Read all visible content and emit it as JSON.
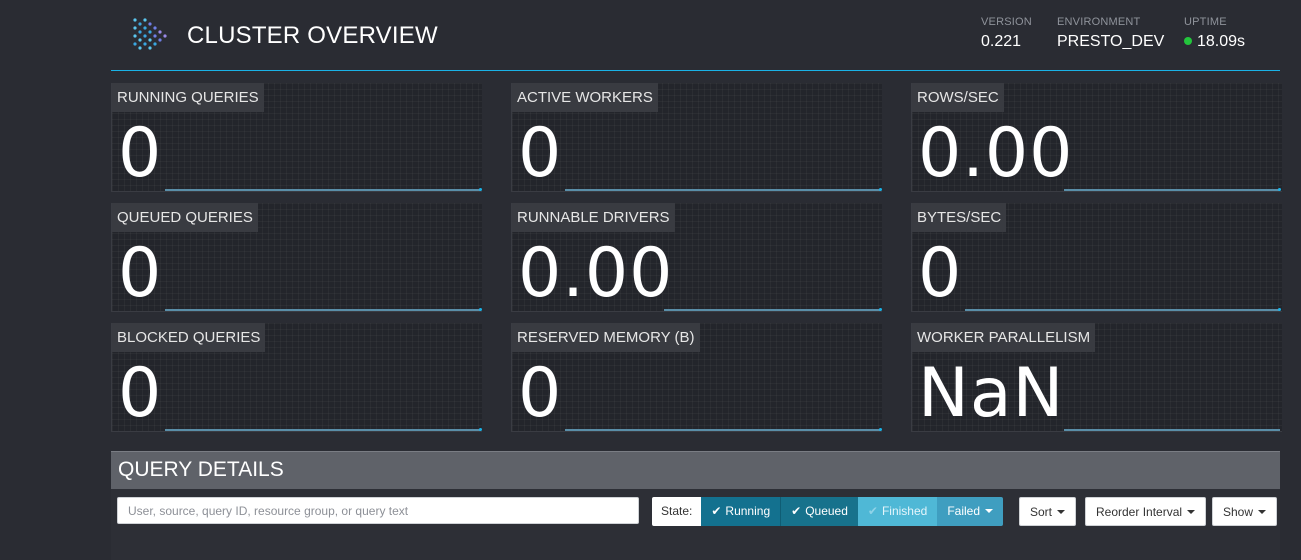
{
  "header": {
    "title": "CLUSTER OVERVIEW",
    "version": {
      "label": "VERSION",
      "value": "0.221"
    },
    "environment": {
      "label": "ENVIRONMENT",
      "value": "PRESTO_DEV"
    },
    "uptime": {
      "label": "UPTIME",
      "value": "18.09s",
      "status_color": "#23c53c"
    }
  },
  "stats": [
    {
      "label": "RUNNING QUERIES",
      "value": "0"
    },
    {
      "label": "ACTIVE WORKERS",
      "value": "0"
    },
    {
      "label": "ROWS/SEC",
      "value": "0.00"
    },
    {
      "label": "QUEUED QUERIES",
      "value": "0"
    },
    {
      "label": "RUNNABLE DRIVERS",
      "value": "0.00"
    },
    {
      "label": "BYTES/SEC",
      "value": "0"
    },
    {
      "label": "BLOCKED QUERIES",
      "value": "0"
    },
    {
      "label": "RESERVED MEMORY (B)",
      "value": "0"
    },
    {
      "label": "WORKER PARALLELISM",
      "value": "NaN"
    }
  ],
  "query_details": {
    "title": "QUERY DETAILS",
    "search_placeholder": "User, source, query ID, resource group, or query text",
    "state_label": "State:",
    "state_filters": [
      {
        "label": "Running",
        "checked": true,
        "color": "#13718f"
      },
      {
        "label": "Queued",
        "checked": true,
        "color": "#17728c"
      },
      {
        "label": "Finished",
        "checked": false,
        "color": "#4fb8d6"
      },
      {
        "label": "Failed",
        "dropdown": true,
        "color": "#3f9ec0"
      }
    ],
    "sort_label": "Sort",
    "reorder_label": "Reorder Interval",
    "show_label": "Show"
  },
  "colors": {
    "background": "#2a2c33",
    "accent": "#1ab2e6",
    "tile_label_bg": "#393b41",
    "details_bar": "#5f6269"
  }
}
